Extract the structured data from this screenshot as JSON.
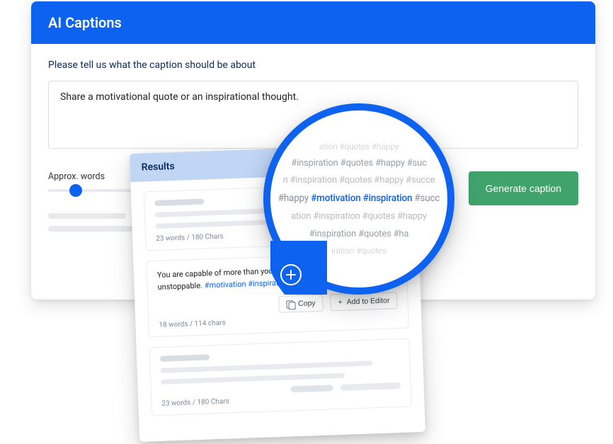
{
  "header": {
    "title": "AI Captions"
  },
  "prompt": {
    "label": "Please tell us what the caption should be about",
    "value": "Share a motivational quote or an inspirational thought."
  },
  "approx": {
    "label": "Approx. words"
  },
  "generate": {
    "label": "Generate caption"
  },
  "results": {
    "title": "Results",
    "items": [
      {
        "meta": "23 words / 180 Chars"
      },
      {
        "text_part1": "You are capable of more than you know. Be",
        "text_part2": "unstoppable. ",
        "hashtags": "#motivation #inspiration",
        "meta": "18 words / 114 chars",
        "copy_label": "Copy",
        "add_label": "Add to Editor"
      },
      {
        "meta": "23 words / 180 Chars"
      }
    ]
  },
  "magnifier": {
    "lines": [
      "ation #quotes #happy",
      "#inspiration #quotes #happy #suc",
      "n #inspiration #quotes #happy #succe",
      {
        "pre": "#happy ",
        "hl": "#motivation #inspiration",
        "post": " #succ"
      },
      "ation #inspiration #quotes #happy",
      "#inspiration #quotes #ha",
      "iration #quotes"
    ]
  }
}
